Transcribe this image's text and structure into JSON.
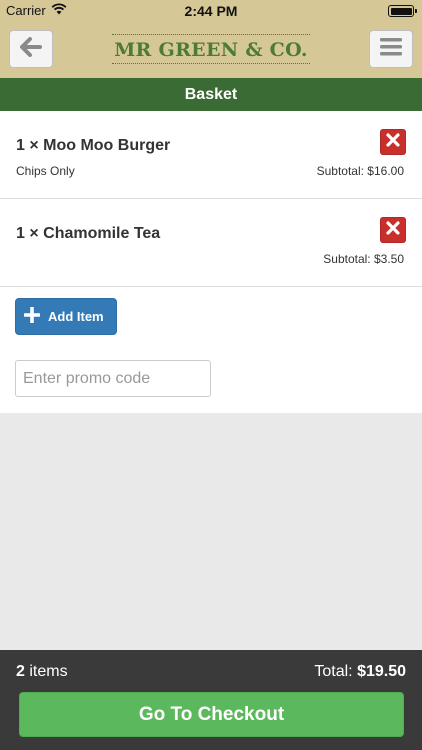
{
  "status_bar": {
    "carrier": "Carrier",
    "time": "2:44 PM"
  },
  "header": {
    "brand": "MR GREEN & CO.",
    "title": "Basket",
    "brand_color": "#4d7a35",
    "bar_color": "#d6c896",
    "title_bar_color": "#3b6b35"
  },
  "basket": {
    "items": [
      {
        "name": "1 × Moo Moo Burger",
        "option": "Chips Only",
        "subtotal": "Subtotal: $16.00"
      },
      {
        "name": "1 × Chamomile Tea",
        "option": "",
        "subtotal": "Subtotal: $3.50"
      }
    ],
    "add_item_label": "Add Item",
    "promo_placeholder": "Enter promo code"
  },
  "footer": {
    "count": "2",
    "count_label": "items",
    "total_label": "Total:",
    "total_value": "$19.50",
    "checkout_label": "Go To Checkout",
    "checkout_color": "#5cb85c"
  },
  "icons": {
    "back": "arrow-left-icon",
    "menu": "hamburger-icon",
    "delete": "close-icon",
    "add": "plus-icon",
    "wifi": "wifi-icon",
    "battery": "battery-icon"
  }
}
